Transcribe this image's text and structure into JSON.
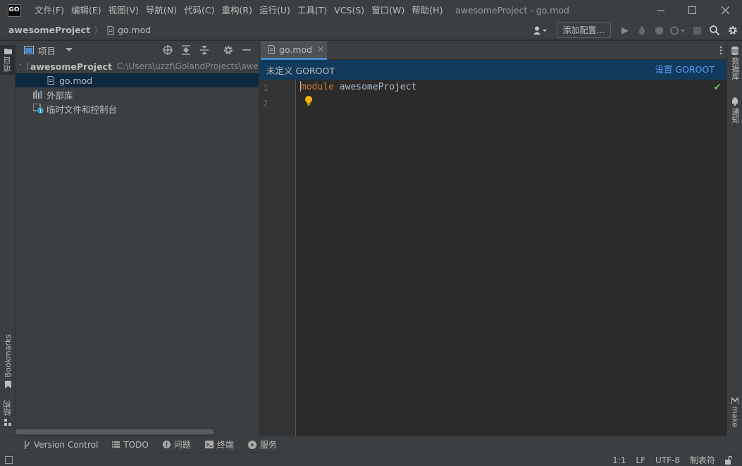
{
  "app": {
    "logo_text": "GO",
    "window_title": "awesomeProject - go.mod"
  },
  "menu": [
    "文件(F)",
    "编辑(E)",
    "视图(V)",
    "导航(N)",
    "代码(C)",
    "重构(R)",
    "运行(U)",
    "工具(T)",
    "VCS(S)",
    "窗口(W)",
    "帮助(H)"
  ],
  "navbar": {
    "project": "awesomeProject",
    "file": "go.mod",
    "add_config_label": "添加配置..."
  },
  "left_strip": {
    "project_tab": "项目",
    "bookmarks_tab": "Bookmarks",
    "structure_tab": "结构"
  },
  "right_strip": {
    "database_tab": "数据库",
    "notifications_tab": "通知",
    "make_tab": "make"
  },
  "project_panel": {
    "title": "项目",
    "tree": {
      "root_name": "awesomeProject",
      "root_path": "C:\\Users\\uzzf\\GolandProjects\\awe",
      "file": "go.mod",
      "external_libs": "外部库",
      "scratches": "临时文件和控制台"
    }
  },
  "editor": {
    "tab_label": "go.mod",
    "banner_text": "未定义 GOROOT",
    "banner_link": "设置 GOROOT",
    "line_numbers": [
      "1",
      "2"
    ],
    "code_keyword": "module",
    "code_identifier": "awesomeProject"
  },
  "bottom_tabs": {
    "vcs": "Version Control",
    "todo": "TODO",
    "problems": "问题",
    "terminal": "终端",
    "services": "服务"
  },
  "status": {
    "position": "1:1",
    "line_sep": "LF",
    "encoding": "UTF-8",
    "indent": "制表符"
  },
  "colors": {
    "accent": "#4a88c7",
    "banner_bg": "#123a5c",
    "link": "#589df6",
    "keyword": "#cc7832",
    "selection": "#0d293e"
  }
}
